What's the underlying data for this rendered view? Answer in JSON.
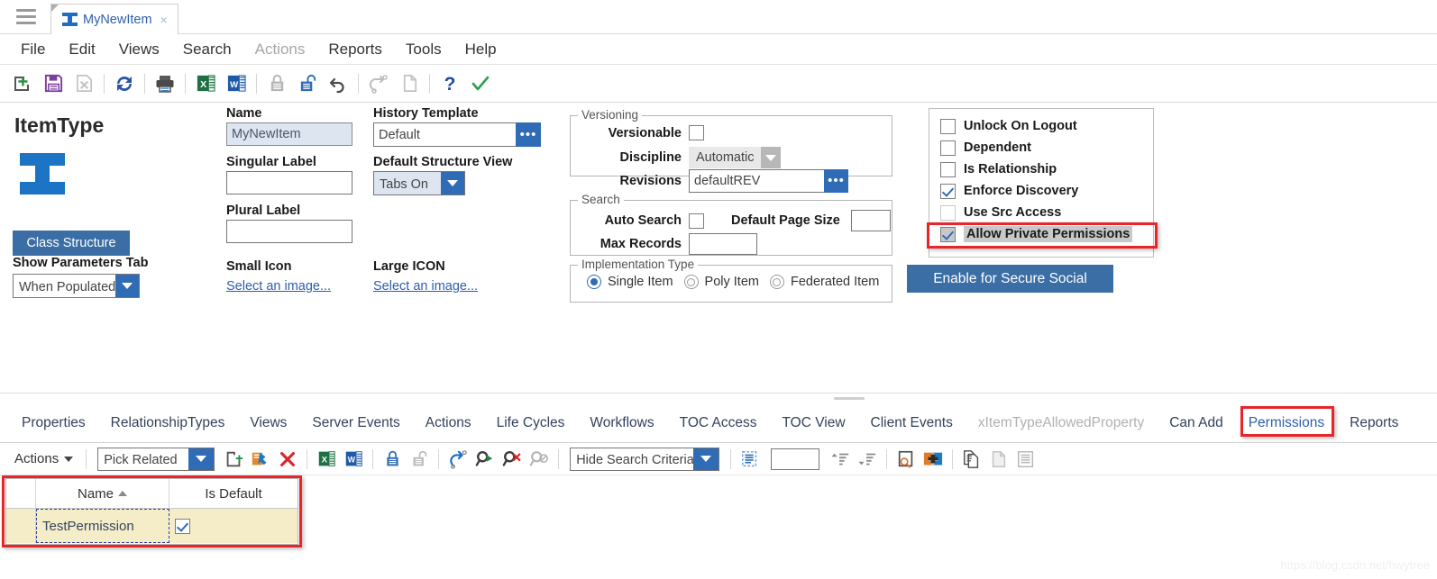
{
  "window": {
    "tab": {
      "title": "MyNewItem",
      "icon": "itemtype-ibeam-icon",
      "close": "×"
    },
    "hamburger_icon": "hamburger-menu-icon"
  },
  "menubar": {
    "items": [
      {
        "label": "File",
        "disabled": false
      },
      {
        "label": "Edit",
        "disabled": false
      },
      {
        "label": "Views",
        "disabled": false
      },
      {
        "label": "Search",
        "disabled": false
      },
      {
        "label": "Actions",
        "disabled": true
      },
      {
        "label": "Reports",
        "disabled": false
      },
      {
        "label": "Tools",
        "disabled": false
      },
      {
        "label": "Help",
        "disabled": false
      }
    ]
  },
  "toolbar": {
    "buttons": [
      {
        "name": "new-item-icon"
      },
      {
        "name": "save-icon"
      },
      {
        "name": "delete-icon"
      },
      {
        "sep": true
      },
      {
        "name": "refresh-icon"
      },
      {
        "sep": true
      },
      {
        "name": "print-icon"
      },
      {
        "sep": true
      },
      {
        "name": "export-excel-icon"
      },
      {
        "name": "export-word-icon"
      },
      {
        "sep": true
      },
      {
        "name": "lock-icon"
      },
      {
        "name": "unlock-icon"
      },
      {
        "name": "undo-icon"
      },
      {
        "sep": true
      },
      {
        "name": "redo-icon"
      },
      {
        "name": "copy-icon"
      },
      {
        "sep": true
      },
      {
        "name": "help-icon"
      },
      {
        "name": "done-icon"
      }
    ]
  },
  "form": {
    "item_type_title": "ItemType",
    "class_structure_button": "Class Structure",
    "show_parameters_tab_label": "Show Parameters Tab",
    "show_parameters_tab_value": "When Populated",
    "name_label": "Name",
    "name_value": "MyNewItem",
    "singular_label_label": "Singular Label",
    "singular_label_value": "",
    "plural_label_label": "Plural Label",
    "plural_label_value": "",
    "small_icon_label": "Small Icon",
    "small_icon_link": "Select an image...",
    "history_template_label": "History Template",
    "history_template_value": "Default",
    "default_structure_view_label": "Default Structure View",
    "default_structure_view_value": "Tabs On",
    "large_icon_label": "Large ICON",
    "large_icon_link": "Select an image...",
    "ellipsis_label": "•••"
  },
  "versioning": {
    "title": "Versioning",
    "versionable_label": "Versionable",
    "versionable_checked": false,
    "discipline_label": "Discipline",
    "discipline_value": "Automatic",
    "revisions_label": "Revisions",
    "revisions_value": "defaultREV"
  },
  "search_group": {
    "title": "Search",
    "auto_search_label": "Auto Search",
    "auto_search_checked": false,
    "default_page_size_label": "Default Page Size",
    "default_page_size_value": "",
    "max_records_label": "Max Records",
    "max_records_value": ""
  },
  "implementation_type": {
    "title": "Implementation Type",
    "options": [
      {
        "label": "Single Item",
        "selected": true
      },
      {
        "label": "Poly Item",
        "selected": false
      },
      {
        "label": "Federated Item",
        "selected": false
      }
    ]
  },
  "flags_panel": {
    "items": [
      {
        "label": "Unlock On Logout",
        "checked": false,
        "highlighted": false
      },
      {
        "label": "Dependent",
        "checked": false,
        "highlighted": false
      },
      {
        "label": "Is Relationship",
        "checked": false,
        "highlighted": false
      },
      {
        "label": "Enforce Discovery",
        "checked": true,
        "highlighted": false
      },
      {
        "label": "Use Src Access",
        "checked": false,
        "highlighted": false
      },
      {
        "label": "Allow Private Permissions",
        "checked": true,
        "highlighted": true
      }
    ],
    "secure_social_button": "Enable for Secure Social"
  },
  "bottom_tabs": {
    "items": [
      {
        "label": "Properties",
        "state": "normal"
      },
      {
        "label": "RelationshipTypes",
        "state": "normal"
      },
      {
        "label": "Views",
        "state": "normal"
      },
      {
        "label": "Server Events",
        "state": "normal"
      },
      {
        "label": "Actions",
        "state": "normal"
      },
      {
        "label": "Life Cycles",
        "state": "normal"
      },
      {
        "label": "Workflows",
        "state": "normal"
      },
      {
        "label": "TOC Access",
        "state": "normal"
      },
      {
        "label": "TOC View",
        "state": "normal"
      },
      {
        "label": "Client Events",
        "state": "normal"
      },
      {
        "label": "xItemTypeAllowedProperty",
        "state": "disabled"
      },
      {
        "label": "Can Add",
        "state": "normal"
      },
      {
        "label": "Permissions",
        "state": "active"
      },
      {
        "label": "Reports",
        "state": "normal"
      }
    ]
  },
  "grid_toolbar": {
    "actions_label": "Actions",
    "pick_related_value": "Pick Related",
    "hide_search_criteria_value": "Hide Search Criteria",
    "page_input_value": "",
    "buttons": [
      {
        "name": "new-relationship-icon"
      },
      {
        "name": "pick-item-icon"
      },
      {
        "name": "delete-row-icon"
      },
      {
        "name": "export-excel-icon"
      },
      {
        "name": "export-word-icon"
      },
      {
        "name": "lock-icon"
      },
      {
        "name": "unlock-icon"
      },
      {
        "name": "promote-icon"
      },
      {
        "name": "run-search-icon"
      },
      {
        "name": "clear-search-icon"
      },
      {
        "name": "disabled-search-icon"
      },
      {
        "name": "select-all-icon"
      },
      {
        "name": "sort-ascending-icon"
      },
      {
        "name": "sort-descending-icon"
      },
      {
        "name": "search-in-page-icon"
      },
      {
        "name": "add-column-icon"
      },
      {
        "name": "copy-icon"
      },
      {
        "name": "paste-icon"
      },
      {
        "name": "list-view-icon"
      }
    ]
  },
  "permissions_grid": {
    "columns": [
      {
        "label": "",
        "key": "num"
      },
      {
        "label": "Name",
        "key": "name",
        "sort": "asc"
      },
      {
        "label": "Is Default",
        "key": "is_default"
      }
    ],
    "rows": [
      {
        "num": "",
        "name": "TestPermission",
        "is_default": true
      }
    ]
  },
  "watermark": "https://blog.csdn.net/hwytree",
  "colors": {
    "accent_blue": "#2f6cb5",
    "button_blue": "#3a6ea5",
    "highlight_red": "#e8262a",
    "row_yellow": "#f5edc8",
    "readonly_field": "#dde5f1"
  }
}
